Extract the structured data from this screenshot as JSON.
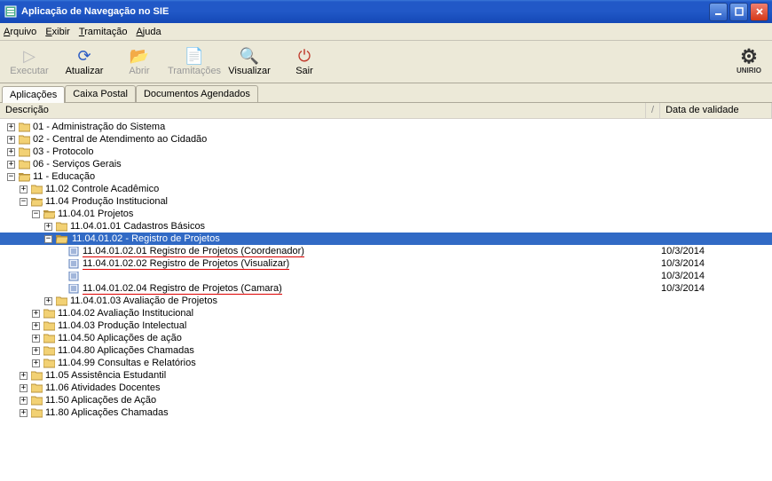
{
  "window": {
    "title": "Aplicação de Navegação no SIE",
    "logo_text": "UNIRIO"
  },
  "menu": {
    "arquivo": "Arquivo",
    "exibir": "Exibir",
    "tramitacao": "Tramitação",
    "ajuda": "Ajuda"
  },
  "toolbar": {
    "executar": "Executar",
    "atualizar": "Atualizar",
    "abrir": "Abrir",
    "tramitacoes": "Tramitações",
    "visualizar": "Visualizar",
    "sair": "Sair"
  },
  "tabs": {
    "aplicacoes": "Aplicações",
    "caixa_postal": "Caixa Postal",
    "documentos": "Documentos Agendados"
  },
  "columns": {
    "descricao": "Descrição",
    "divider": "/",
    "data_validade": "Data de validade"
  },
  "tree": [
    {
      "indent": 0,
      "exp": "+",
      "icon": "folder",
      "label": "01 - Administração do Sistema"
    },
    {
      "indent": 0,
      "exp": "+",
      "icon": "folder",
      "label": "02 - Central de Atendimento ao Cidadão"
    },
    {
      "indent": 0,
      "exp": "+",
      "icon": "folder",
      "label": "03 - Protocolo"
    },
    {
      "indent": 0,
      "exp": "+",
      "icon": "folder",
      "label": "06 - Serviços Gerais"
    },
    {
      "indent": 0,
      "exp": "-",
      "icon": "folderopen",
      "label": "11 - Educação"
    },
    {
      "indent": 1,
      "exp": "+",
      "icon": "folder",
      "label": "11.02 Controle Acadêmico"
    },
    {
      "indent": 1,
      "exp": "-",
      "icon": "folderopen",
      "label": "11.04 Produção Institucional"
    },
    {
      "indent": 2,
      "exp": "-",
      "icon": "folderopen",
      "label": "11.04.01 Projetos"
    },
    {
      "indent": 3,
      "exp": "+",
      "icon": "folder",
      "label": "11.04.01.01 Cadastros Básicos"
    },
    {
      "indent": 3,
      "exp": "-",
      "icon": "folderopen",
      "label": "11.04.01.02 - Registro de Projetos",
      "selected": true
    },
    {
      "indent": 4,
      "exp": "",
      "icon": "doc",
      "label": "11.04.01.02.01 Registro de Projetos (Coordenador)",
      "underline": true,
      "date": "10/3/2014"
    },
    {
      "indent": 4,
      "exp": "",
      "icon": "doc",
      "label": "11.04.01.02.02 Registro de Projetos (Visualizar)",
      "underline": true,
      "date": "10/3/2014"
    },
    {
      "indent": 4,
      "exp": "",
      "icon": "doc",
      "label": "",
      "date": "10/3/2014"
    },
    {
      "indent": 4,
      "exp": "",
      "icon": "doc",
      "label": "11.04.01.02.04 Registro de Projetos (Camara)",
      "underline": true,
      "date": "10/3/2014"
    },
    {
      "indent": 3,
      "exp": "+",
      "icon": "folder",
      "label": "11.04.01.03 Avaliação de Projetos"
    },
    {
      "indent": 2,
      "exp": "+",
      "icon": "folder",
      "label": "11.04.02 Avaliação Institucional"
    },
    {
      "indent": 2,
      "exp": "+",
      "icon": "folder",
      "label": "11.04.03 Produção Intelectual"
    },
    {
      "indent": 2,
      "exp": "+",
      "icon": "folder",
      "label": "11.04.50 Aplicações de ação"
    },
    {
      "indent": 2,
      "exp": "+",
      "icon": "folder",
      "label": "11.04.80 Aplicações Chamadas"
    },
    {
      "indent": 2,
      "exp": "+",
      "icon": "folder",
      "label": "11.04.99 Consultas e Relatórios"
    },
    {
      "indent": 1,
      "exp": "+",
      "icon": "folder",
      "label": "11.05 Assistência Estudantil"
    },
    {
      "indent": 1,
      "exp": "+",
      "icon": "folder",
      "label": "11.06 Atividades Docentes"
    },
    {
      "indent": 1,
      "exp": "+",
      "icon": "folder",
      "label": "11.50 Aplicações de Ação"
    },
    {
      "indent": 1,
      "exp": "+",
      "icon": "folder",
      "label": "11.80 Aplicações Chamadas"
    }
  ]
}
